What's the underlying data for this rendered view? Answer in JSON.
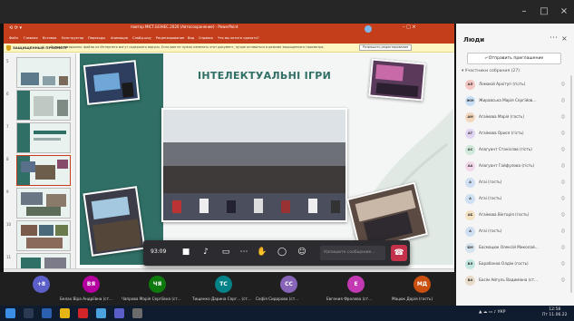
{
  "window": {
    "controls": [
      "–",
      "□",
      "×"
    ]
  },
  "ppt": {
    "title": "повтор МІСТ.БІЗНЕС.2020 (Автосохранение) - PowerPoint",
    "ribbon_tabs": [
      "Файл",
      "Главная",
      "Вставка",
      "Конструктор",
      "Переходы",
      "Анимация",
      "Слайд-шоу",
      "Рецензирование",
      "Вид",
      "Справка",
      "Что вы хотите сделать?"
    ],
    "message_label": "ЗАЩИЩЕННЫЙ ПРОСМОТР",
    "message_text": "Будьте осторожны: файлы из Интернета могут содержать вирусы. Если вам не нужно изменять этот документ, лучше оставаться в режиме защищенного просмотра.",
    "message_button": "Разрешить редактирование",
    "slide_heading": "ІНТЕЛЕКТУАЛЬНІ ІГРИ",
    "status_left": "Слайд 8 из 34",
    "status_lang": "Русский (Россия)",
    "thumbnail_numbers": [
      "5",
      "6",
      "7",
      "8",
      "9",
      "10",
      "11"
    ]
  },
  "call": {
    "timer": "93:09",
    "message_placeholder": "Напишите сообщение…",
    "controls": [
      "camera-icon",
      "mic-icon",
      "share-icon",
      "more-icon",
      "raise-hand-icon",
      "chat-icon",
      "participants-icon"
    ]
  },
  "inner_taskbar": {
    "tray": "▲ ◆ ▮ ♪ УКР",
    "time": "14:38",
    "date": "11.06.2021"
  },
  "strip": {
    "participants": [
      {
        "initials": "+8",
        "name": "",
        "color": "#5b5fc7"
      },
      {
        "initials": "ВЯ",
        "name": "Белах Віра Андріївна (ст...",
        "color": "#b4009e"
      },
      {
        "initials": "ЧЯ",
        "name": "Чапрова Марія Сергіївна (ст...",
        "color": "#0e7a0d"
      },
      {
        "initials": "ТС",
        "name": "Тищенко Дарина Серг... (ст...",
        "color": "#038387"
      },
      {
        "initials": "СС",
        "name": "Софія Сидорова (ст...",
        "color": "#8764b8"
      },
      {
        "initials": "Е",
        "name": "Евгения Фролова (ст...",
        "color": "#c239b3"
      },
      {
        "initials": "МД",
        "name": "Мацюк Дарія (гость)",
        "color": "#ca5010"
      }
    ]
  },
  "host_taskbar": {
    "tray": "▲ ☁ ▭ ♪ УКР",
    "time": "12:58",
    "date": "Пт 11.06.22"
  },
  "people": {
    "title": "Люди",
    "share_button": "Отправить приглашение",
    "section": "Участники собрания (27)",
    "rows": [
      {
        "initials": "АЛ",
        "name": "Ломакій Архітуп (гість)",
        "color": "#f4c7c3"
      },
      {
        "initials": "ЖМ",
        "name": "Жиравська Марія Сергійов...",
        "color": "#c7dff4"
      },
      {
        "initials": "АМ",
        "name": "Агаімова Марія (гость)",
        "color": "#f4d7bf"
      },
      {
        "initials": "АТ",
        "name": "Агаімова Орися (гість)",
        "color": "#e1d4f2"
      },
      {
        "initials": "АС",
        "name": "Алагуант Станіслав (гість)",
        "color": "#d0e8d8"
      },
      {
        "initials": "АА",
        "name": "Алагуант Гайфулова (гість)",
        "color": "#f2d8e8"
      },
      {
        "initials": "А",
        "name": "Агаі (гость)",
        "color": "#cfe0f2"
      },
      {
        "initials": "А",
        "name": "Агаі (гость)",
        "color": "#cfe0f2"
      },
      {
        "initials": "АБ",
        "name": "Агаімова Вікторія (гость)",
        "color": "#f4e3c3"
      },
      {
        "initials": "А",
        "name": "Агаі (гость)",
        "color": "#cfe0f2"
      },
      {
        "initials": "БМ",
        "name": "Басмацюк Олексій Миколай...",
        "color": "#d6e4f0"
      },
      {
        "initials": "ВЛ",
        "name": "Барабанов Олдім (гость)",
        "color": "#c3e6e0"
      },
      {
        "initials": "ВА",
        "name": "Басім Айгуль Вадимівна (ст...",
        "color": "#e8dcc8"
      }
    ]
  }
}
